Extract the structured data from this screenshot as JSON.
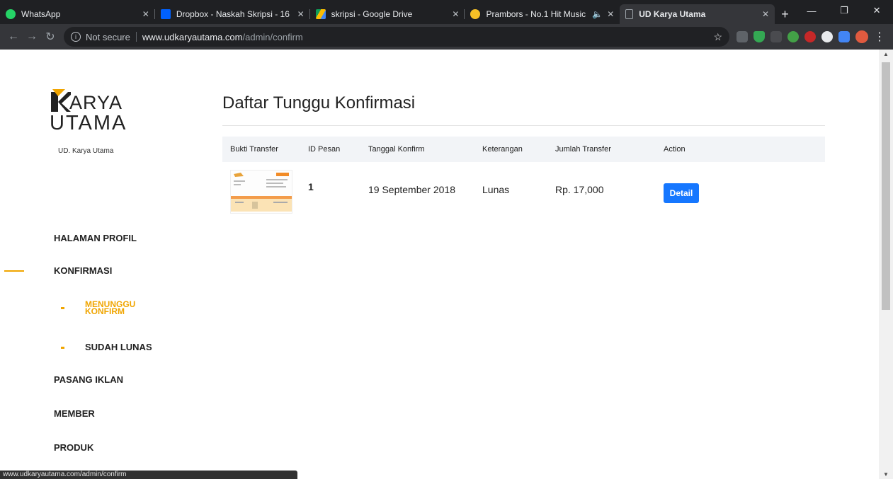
{
  "browser": {
    "tabs": [
      {
        "title": "WhatsApp",
        "color": "#25d366"
      },
      {
        "title": "Dropbox - Naskah Skripsi - 16",
        "color": "#0061ff"
      },
      {
        "title": "skripsi - Google Drive",
        "color": "#fbbc04"
      },
      {
        "title": "Prambors - No.1 Hit Music",
        "color": "#f6c026"
      },
      {
        "title": "UD Karya Utama",
        "color": "#9aa0a6"
      }
    ],
    "address": {
      "security": "Not secure",
      "host": "www.udkaryautama.com",
      "path": "/admin/confirm"
    },
    "status_url": "www.udkaryautama.com/admin/confirm"
  },
  "brand": {
    "line1": "ARYA",
    "line2": "UTAMA",
    "subtitle": "UD. Karya Utama",
    "accent": "#f0a500"
  },
  "sidebar": {
    "items": [
      {
        "label": "HALAMAN PROFIL"
      },
      {
        "label": "KONFIRMASI"
      },
      {
        "label": "PASANG IKLAN"
      },
      {
        "label": "MEMBER"
      },
      {
        "label": "PRODUK"
      }
    ],
    "sub_items": [
      {
        "line1": "MENUNGGU",
        "line2": "KONFIRM"
      },
      {
        "label": "SUDAH LUNAS"
      }
    ]
  },
  "main": {
    "title": "Daftar Tunggu Konfirmasi",
    "columns": [
      "Bukti Transfer",
      "ID Pesan",
      "Tanggal Konfirm",
      "Keterangan",
      "Jumlah Transfer",
      "Action"
    ],
    "rows": [
      {
        "id": "1",
        "date": "19 September 2018",
        "status": "Lunas",
        "amount": "Rp. 17,000",
        "action": "Detail"
      }
    ]
  }
}
